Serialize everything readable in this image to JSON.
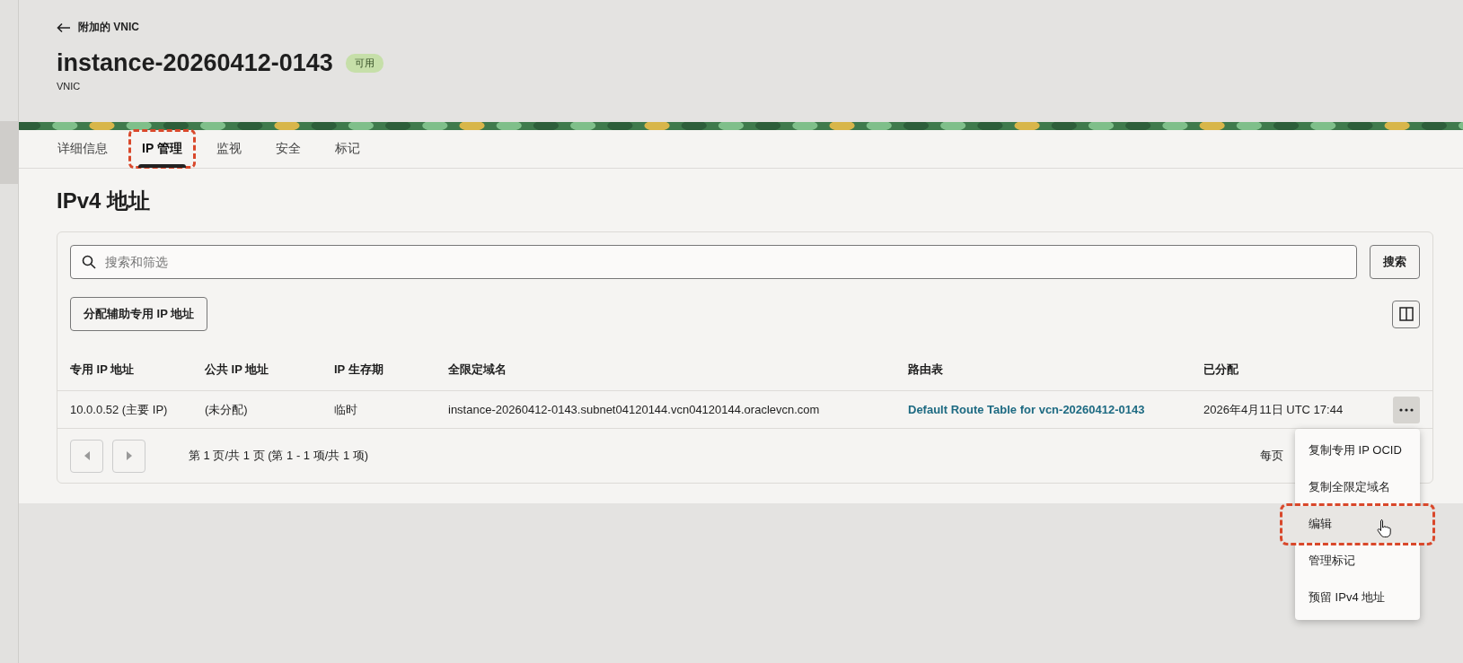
{
  "breadcrumb": {
    "label": "附加的 VNIC"
  },
  "header": {
    "title": "instance-20260412-0143",
    "status": "可用",
    "subtitle": "VNIC"
  },
  "tabs": [
    {
      "label": "详细信息",
      "selected": false,
      "annotated": false
    },
    {
      "label": "IP 管理",
      "selected": true,
      "annotated": true
    },
    {
      "label": "监视",
      "selected": false,
      "annotated": false
    },
    {
      "label": "安全",
      "selected": false,
      "annotated": false
    },
    {
      "label": "标记",
      "selected": false,
      "annotated": false
    }
  ],
  "section_title": "IPv4 地址",
  "search": {
    "placeholder": "搜索和筛选",
    "button": "搜索"
  },
  "action_button": "分配辅助专用 IP 地址",
  "table": {
    "columns": [
      "专用 IP 地址",
      "公共 IP 地址",
      "IP 生存期",
      "全限定域名",
      "路由表",
      "已分配"
    ],
    "rows": [
      {
        "cells": [
          "10.0.0.52 (主要 IP)",
          "(未分配)",
          "临时",
          "instance-20260412-0143.subnet04120144.vcn04120144.oraclevcn.com",
          "Default Route Table for vcn-20260412-0143",
          "2026年4月11日 UTC 17:44"
        ],
        "menu_open": true
      }
    ]
  },
  "pagination": {
    "summary": "第 1 页/共 1 页 (第 1 - 1 项/共 1 项)",
    "per_page_label": "每页"
  },
  "row_menu": [
    {
      "label": "复制专用 IP OCID",
      "hovered": false,
      "annotated": false
    },
    {
      "label": "复制全限定域名",
      "hovered": false,
      "annotated": false
    },
    {
      "label": "编辑",
      "hovered": true,
      "annotated": true
    },
    {
      "label": "管理标记",
      "hovered": false,
      "annotated": false
    },
    {
      "label": "预留 IPv4 地址",
      "hovered": false,
      "annotated": false
    }
  ]
}
